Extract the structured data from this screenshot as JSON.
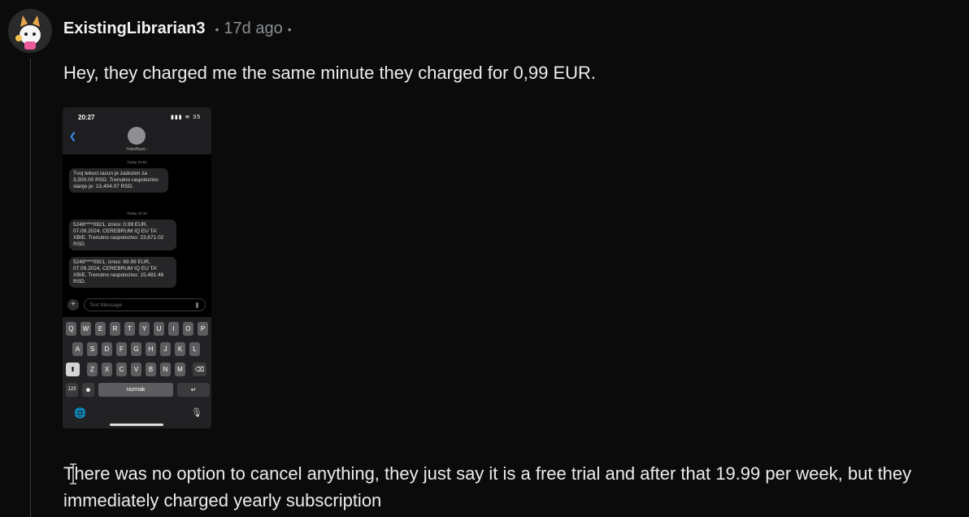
{
  "comment": {
    "username": "ExistingLibrarian3",
    "time": "17d ago",
    "separator": "•",
    "text_line1": "Hey, they charged me the same minute they charged for 0,99 EUR.",
    "text_line2": "There was no option to cancel anything, they just say it is a free trial and after that 19.99 per week, but they immediately charged yearly subscription"
  },
  "screenshot": {
    "clock": "20:27",
    "status": "▮▮▮ ≋ 35",
    "back": "❮",
    "contact": "YettelBank ›",
    "day1": "Today 16:52",
    "msg1": "Tvoj tekuci racun je zaduzen za 3,500.00 RSD. Trenutno raspolozivo stanje je: 13,404.07 RSD.",
    "day2": "Today 20:18",
    "msg2": "5248****0921, iznos: 0.99 EUR, 07.09.2024, CEREBRUM IQ EU TA' XBIE. Trenutno raspolozivo: 23,671.02 RSD.",
    "msg3": "5248****0921, iznos: 69.99 EUR, 07.09.2024, CEREBRUM IQ EU TA' XBIE. Trenutno raspolozivo: 15,481.46 RSD.",
    "plus": "+",
    "placeholder": "Text Message",
    "row1": [
      "Q",
      "W",
      "E",
      "R",
      "T",
      "Y",
      "U",
      "I",
      "O",
      "P"
    ],
    "row2": [
      "A",
      "S",
      "D",
      "F",
      "G",
      "H",
      "J",
      "K",
      "L"
    ],
    "row3": [
      "Z",
      "X",
      "C",
      "V",
      "B",
      "N",
      "M"
    ],
    "shift": "⬆",
    "delete": "⌫",
    "num": "123",
    "emoji": "☻",
    "space": "razmak",
    "return": "↵",
    "globe": "🌐",
    "mic": "🎙"
  },
  "colors": {
    "background": "#0b0b0b",
    "meta": "#8a8f93",
    "link": "#3b8df5"
  },
  "icons": {
    "avatar": "avatar-icon",
    "text_cursor": "text-cursor-icon"
  }
}
